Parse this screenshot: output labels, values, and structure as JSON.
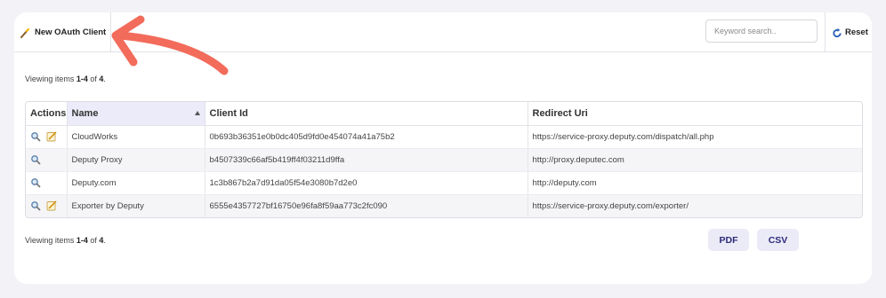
{
  "toolbar": {
    "new_client_label": "New OAuth Client",
    "search_placeholder": "Keyword search..",
    "reset_label": "Reset"
  },
  "summary_top": {
    "prefix": "Viewing items ",
    "range": "1-4",
    "middle": " of ",
    "total": "4",
    "suffix": "."
  },
  "summary_bottom": {
    "prefix": "Viewing items ",
    "range": "1-4",
    "middle": " of ",
    "total": "4",
    "suffix": "."
  },
  "table": {
    "columns": [
      "Actions",
      "Name",
      "Client Id",
      "Redirect Uri"
    ],
    "sorted_column": "Name",
    "sort_direction": "ascending",
    "rows": [
      {
        "name": "CloudWorks",
        "client_id": "0b693b36351e0b0dc405d9fd0e454074a41a75b2",
        "redirect_uri": "https://service-proxy.deputy.com/dispatch/all.php",
        "actions": [
          "view-icon",
          "edit-icon"
        ]
      },
      {
        "name": "Deputy Proxy",
        "client_id": "b4507339c66af5b419ff4f03211d9ffa",
        "redirect_uri": "http://proxy.deputec.com",
        "actions": [
          "view-icon"
        ]
      },
      {
        "name": "Deputy.com",
        "client_id": "1c3b867b2a7d91da05f54e3080b7d2e0",
        "redirect_uri": "http://deputy.com",
        "actions": [
          "view-icon"
        ]
      },
      {
        "name": "Exporter by Deputy",
        "client_id": "6555e4357727bf16750e96fa8f59aa773c2fc090",
        "redirect_uri": "https://service-proxy.deputy.com/exporter/",
        "actions": [
          "view-icon",
          "edit-icon"
        ]
      }
    ]
  },
  "export": {
    "pdf_label": "PDF",
    "csv_label": "CSV"
  },
  "colors": {
    "annotation_arrow": "#f26b5b",
    "button_bg": "#ebeaf7",
    "button_text": "#2e2a7a",
    "sorted_header_bg": "#ebebf9",
    "page_bg": "#f3f3f7"
  }
}
